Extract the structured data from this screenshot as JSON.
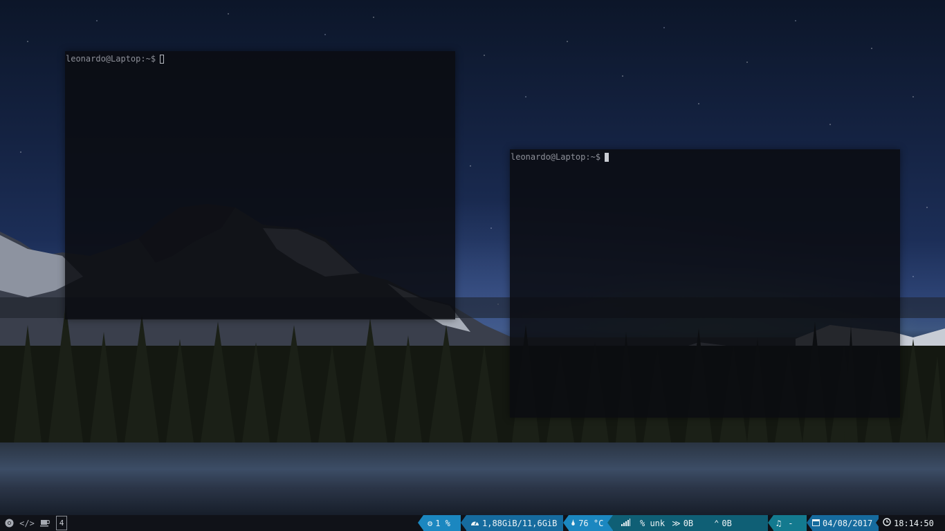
{
  "terminals": [
    {
      "prompt": "leonardo@Laptop:~$",
      "cursor": "hollow"
    },
    {
      "prompt": "leonardo@Laptop:~$",
      "cursor": "solid"
    }
  ],
  "bar": {
    "left": {
      "icons": [
        "chrome-icon",
        "code-icon",
        "coffee-icon"
      ],
      "workspace": "4"
    },
    "cpu": {
      "icon": "gear-icon",
      "text": "1 %"
    },
    "memory": {
      "icon": "dashboard-icon",
      "text": "1,88GiB/11,6GiB"
    },
    "temperature": {
      "icon": "thermometer-icon",
      "text": "76 °C"
    },
    "wifi": {
      "icon": "signal-icon",
      "text": "% unk"
    },
    "download": {
      "icon": "chevron-down-icon",
      "text": "0B"
    },
    "upload": {
      "icon": "chevron-up-icon",
      "text": "0B"
    },
    "music": {
      "icon": "music-note-icon",
      "text": "-"
    },
    "date": {
      "icon": "calendar-icon",
      "text": "04/08/2017"
    },
    "time": {
      "icon": "clock-icon",
      "text": "18:14:50"
    },
    "colors": {
      "bar_bg": "#101218",
      "accent_blue": "#1b87c0",
      "accent_teal": "#0f5f75"
    }
  }
}
